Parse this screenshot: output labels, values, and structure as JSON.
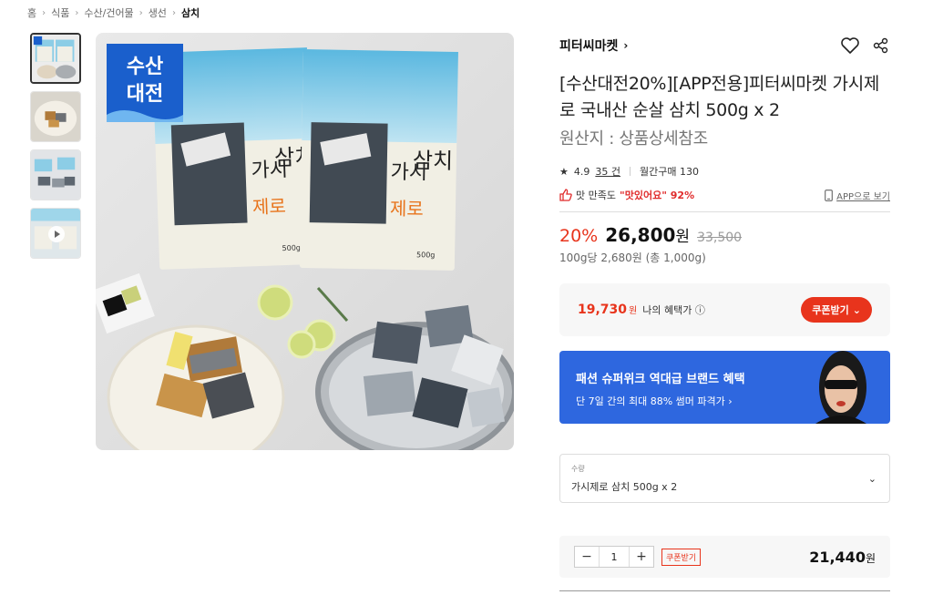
{
  "breadcrumb": [
    "홈",
    "식품",
    "수산/건어물",
    "생선",
    "삼치"
  ],
  "thumbnails": [
    {
      "name": "thumb-1-product-packages",
      "active": true
    },
    {
      "name": "thumb-2-cooked-fish"
    },
    {
      "name": "thumb-3-packages-fish"
    },
    {
      "name": "thumb-4-video",
      "video": true
    }
  ],
  "main_image": {
    "badge_line1": "수산",
    "badge_line2": "대전",
    "pkg_title_a": "삼치",
    "pkg_title_b": "가시",
    "pkg_title_c": "제로",
    "pkg_weight": "500g"
  },
  "seller": {
    "name": "피터씨마켓",
    "chevron": "›"
  },
  "icons": {
    "like": "heart-icon",
    "share": "share-icon"
  },
  "product": {
    "title": "[수산대전20%][APP전용]피터씨마켓 가시제로 국내산 순살 삼치 500g x 2",
    "origin": "원산지 : 상품상세참조",
    "rating": "4.9",
    "review_count": "35 건",
    "monthly_sales": "월간구매 130",
    "taste_prefix": "맛 만족도",
    "taste_highlight": "\"맛있어요\" 92%",
    "app_view": "APP으로 보기"
  },
  "price": {
    "discount": "20%",
    "sale": "26,800",
    "won": "원",
    "original": "33,500",
    "per_unit": "100g당 2,680원 (총 1,000g)"
  },
  "benefit": {
    "amount": "19,730",
    "won": "원",
    "label": "나의 혜택가",
    "coupon_button": "쿠폰받기"
  },
  "banner": {
    "line1": "패션 슈퍼위크 역대급 브랜드 혜택",
    "line2": "단 7일 간의 최대 88% 썸머 파격가 ›"
  },
  "option": {
    "label": "수량",
    "value": "가시제로 삼치 500g x 2"
  },
  "cart": {
    "minus": "−",
    "qty": "1",
    "plus": "+",
    "coupon": "쿠폰받기",
    "total": "21,440",
    "won": "원"
  },
  "colors": {
    "accent_red": "#e8341c",
    "banner_blue": "#2e67df",
    "badge_blue": "#1a5fcc",
    "package_blue": "#7ec9e6"
  }
}
